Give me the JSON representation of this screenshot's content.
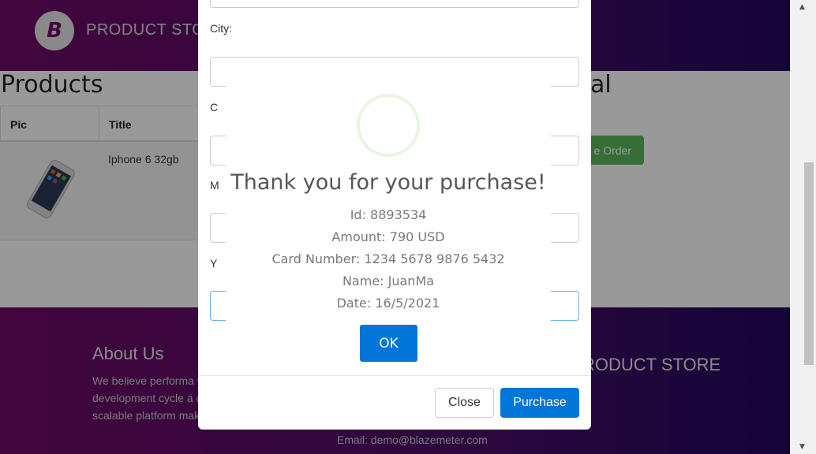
{
  "navbar": {
    "logo_letter": "B",
    "brand": "PRODUCT STORE"
  },
  "products": {
    "title": "Products",
    "total_fragment": "al",
    "columns": [
      "Pic",
      "Title"
    ],
    "rows": [
      {
        "title": "Iphone 6 32gb"
      }
    ],
    "place_order_fragment": "e Order"
  },
  "footer": {
    "about_title": "About Us",
    "about_text": "We believe performa validated at every sta development cycle a compatible, massively scalable platform makes that a reality.",
    "brand_fragment": "RODUCT STORE",
    "email": "Email: demo@blazemeter.com"
  },
  "modal": {
    "city_label": "City:",
    "label_fragments": [
      "C",
      "M",
      "Y"
    ],
    "close_label": "Close",
    "purchase_label": "Purchase"
  },
  "alert": {
    "title": "Thank you for your purchase!",
    "lines": [
      "Id: 8893534",
      "Amount: 790 USD",
      "Card Number: 1234 5678 9876 5432",
      "Name: JuanMa",
      "Date: 16/5/2021"
    ],
    "ok_label": "OK"
  },
  "colors": {
    "primary": "#0275d8",
    "success": "#5cb85c",
    "nav_purple": "#6e0a66"
  }
}
